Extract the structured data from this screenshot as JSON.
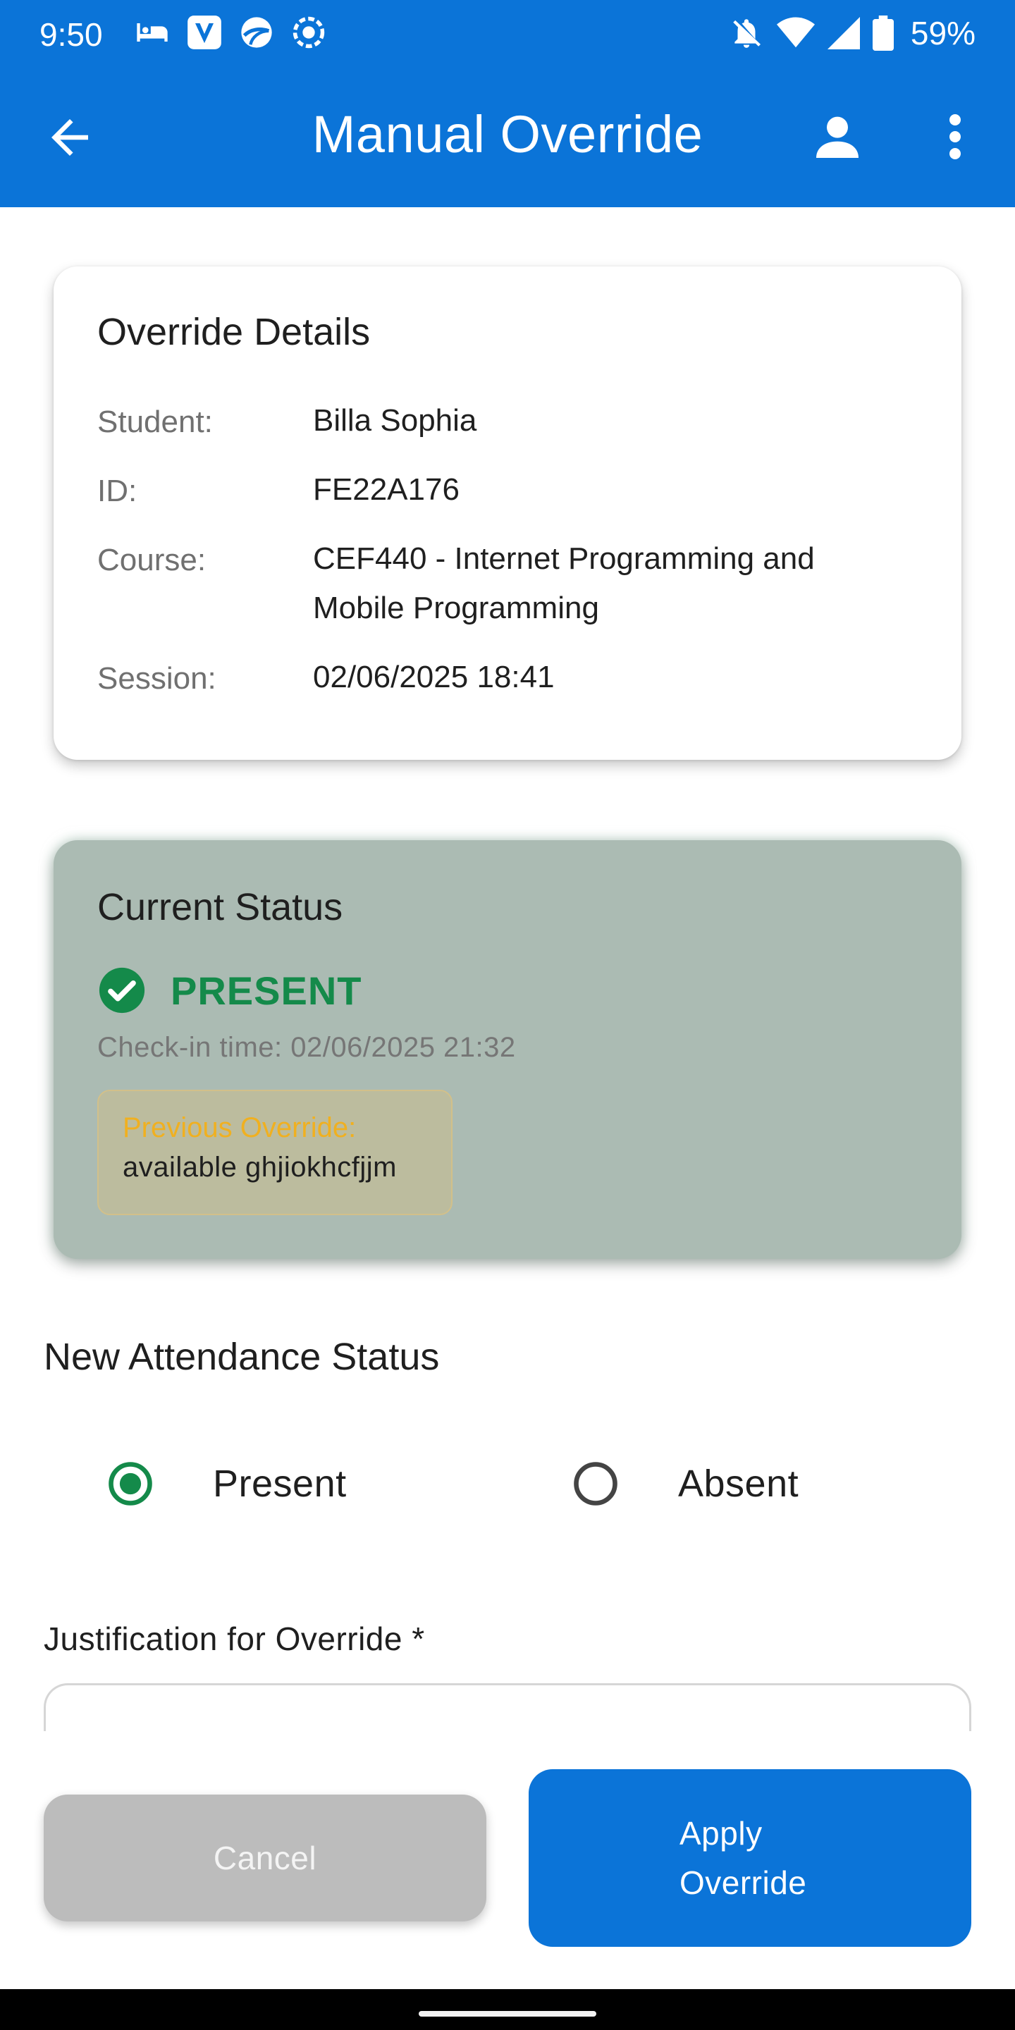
{
  "status_bar": {
    "time": "9:50",
    "battery": "59%",
    "left_icons": [
      "bed-icon",
      "v-app-icon",
      "ball-icon",
      "record-icon"
    ],
    "right_icons": [
      "bell-off-icon",
      "wifi-icon",
      "signal-icon",
      "battery-icon"
    ]
  },
  "app_bar": {
    "title": "Manual Override",
    "color": "#0b74d8"
  },
  "details": {
    "title": "Override Details",
    "student_label": "Student:",
    "student_value": "Billa Sophia",
    "id_label": "ID:",
    "id_value": "FE22A176",
    "course_label": "Course:",
    "course_value_line1": "CEF440 - Internet Programming and",
    "course_value_line2": "Mobile Programming",
    "session_label": "Session:",
    "session_value": "02/06/2025 18:41"
  },
  "current_status": {
    "title": "Current Status",
    "status": "PRESENT",
    "status_color": "#148a4a",
    "checkin": "Check-in time: 02/06/2025 21:32",
    "previous_override_label": "Previous Override:",
    "previous_override_value": "available ghjiokhcfjjm"
  },
  "new_status": {
    "title": "New Attendance Status",
    "options": [
      "Present",
      "Absent"
    ],
    "selected": "Present"
  },
  "justification": {
    "label": "Justification for Override *",
    "value": ""
  },
  "buttons": {
    "cancel": "Cancel",
    "apply_line1": "Apply",
    "apply_line2": "Override"
  }
}
